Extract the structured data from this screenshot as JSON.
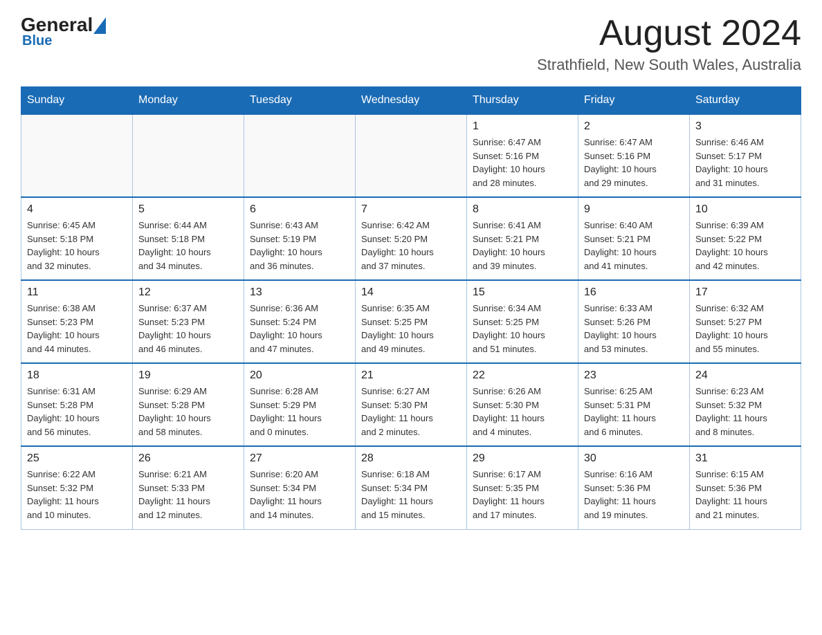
{
  "header": {
    "logo_general": "General",
    "logo_blue": "Blue",
    "title": "August 2024",
    "subtitle": "Strathfield, New South Wales, Australia"
  },
  "columns": [
    "Sunday",
    "Monday",
    "Tuesday",
    "Wednesday",
    "Thursday",
    "Friday",
    "Saturday"
  ],
  "weeks": [
    [
      {
        "day": "",
        "info": ""
      },
      {
        "day": "",
        "info": ""
      },
      {
        "day": "",
        "info": ""
      },
      {
        "day": "",
        "info": ""
      },
      {
        "day": "1",
        "info": "Sunrise: 6:47 AM\nSunset: 5:16 PM\nDaylight: 10 hours\nand 28 minutes."
      },
      {
        "day": "2",
        "info": "Sunrise: 6:47 AM\nSunset: 5:16 PM\nDaylight: 10 hours\nand 29 minutes."
      },
      {
        "day": "3",
        "info": "Sunrise: 6:46 AM\nSunset: 5:17 PM\nDaylight: 10 hours\nand 31 minutes."
      }
    ],
    [
      {
        "day": "4",
        "info": "Sunrise: 6:45 AM\nSunset: 5:18 PM\nDaylight: 10 hours\nand 32 minutes."
      },
      {
        "day": "5",
        "info": "Sunrise: 6:44 AM\nSunset: 5:18 PM\nDaylight: 10 hours\nand 34 minutes."
      },
      {
        "day": "6",
        "info": "Sunrise: 6:43 AM\nSunset: 5:19 PM\nDaylight: 10 hours\nand 36 minutes."
      },
      {
        "day": "7",
        "info": "Sunrise: 6:42 AM\nSunset: 5:20 PM\nDaylight: 10 hours\nand 37 minutes."
      },
      {
        "day": "8",
        "info": "Sunrise: 6:41 AM\nSunset: 5:21 PM\nDaylight: 10 hours\nand 39 minutes."
      },
      {
        "day": "9",
        "info": "Sunrise: 6:40 AM\nSunset: 5:21 PM\nDaylight: 10 hours\nand 41 minutes."
      },
      {
        "day": "10",
        "info": "Sunrise: 6:39 AM\nSunset: 5:22 PM\nDaylight: 10 hours\nand 42 minutes."
      }
    ],
    [
      {
        "day": "11",
        "info": "Sunrise: 6:38 AM\nSunset: 5:23 PM\nDaylight: 10 hours\nand 44 minutes."
      },
      {
        "day": "12",
        "info": "Sunrise: 6:37 AM\nSunset: 5:23 PM\nDaylight: 10 hours\nand 46 minutes."
      },
      {
        "day": "13",
        "info": "Sunrise: 6:36 AM\nSunset: 5:24 PM\nDaylight: 10 hours\nand 47 minutes."
      },
      {
        "day": "14",
        "info": "Sunrise: 6:35 AM\nSunset: 5:25 PM\nDaylight: 10 hours\nand 49 minutes."
      },
      {
        "day": "15",
        "info": "Sunrise: 6:34 AM\nSunset: 5:25 PM\nDaylight: 10 hours\nand 51 minutes."
      },
      {
        "day": "16",
        "info": "Sunrise: 6:33 AM\nSunset: 5:26 PM\nDaylight: 10 hours\nand 53 minutes."
      },
      {
        "day": "17",
        "info": "Sunrise: 6:32 AM\nSunset: 5:27 PM\nDaylight: 10 hours\nand 55 minutes."
      }
    ],
    [
      {
        "day": "18",
        "info": "Sunrise: 6:31 AM\nSunset: 5:28 PM\nDaylight: 10 hours\nand 56 minutes."
      },
      {
        "day": "19",
        "info": "Sunrise: 6:29 AM\nSunset: 5:28 PM\nDaylight: 10 hours\nand 58 minutes."
      },
      {
        "day": "20",
        "info": "Sunrise: 6:28 AM\nSunset: 5:29 PM\nDaylight: 11 hours\nand 0 minutes."
      },
      {
        "day": "21",
        "info": "Sunrise: 6:27 AM\nSunset: 5:30 PM\nDaylight: 11 hours\nand 2 minutes."
      },
      {
        "day": "22",
        "info": "Sunrise: 6:26 AM\nSunset: 5:30 PM\nDaylight: 11 hours\nand 4 minutes."
      },
      {
        "day": "23",
        "info": "Sunrise: 6:25 AM\nSunset: 5:31 PM\nDaylight: 11 hours\nand 6 minutes."
      },
      {
        "day": "24",
        "info": "Sunrise: 6:23 AM\nSunset: 5:32 PM\nDaylight: 11 hours\nand 8 minutes."
      }
    ],
    [
      {
        "day": "25",
        "info": "Sunrise: 6:22 AM\nSunset: 5:32 PM\nDaylight: 11 hours\nand 10 minutes."
      },
      {
        "day": "26",
        "info": "Sunrise: 6:21 AM\nSunset: 5:33 PM\nDaylight: 11 hours\nand 12 minutes."
      },
      {
        "day": "27",
        "info": "Sunrise: 6:20 AM\nSunset: 5:34 PM\nDaylight: 11 hours\nand 14 minutes."
      },
      {
        "day": "28",
        "info": "Sunrise: 6:18 AM\nSunset: 5:34 PM\nDaylight: 11 hours\nand 15 minutes."
      },
      {
        "day": "29",
        "info": "Sunrise: 6:17 AM\nSunset: 5:35 PM\nDaylight: 11 hours\nand 17 minutes."
      },
      {
        "day": "30",
        "info": "Sunrise: 6:16 AM\nSunset: 5:36 PM\nDaylight: 11 hours\nand 19 minutes."
      },
      {
        "day": "31",
        "info": "Sunrise: 6:15 AM\nSunset: 5:36 PM\nDaylight: 11 hours\nand 21 minutes."
      }
    ]
  ]
}
